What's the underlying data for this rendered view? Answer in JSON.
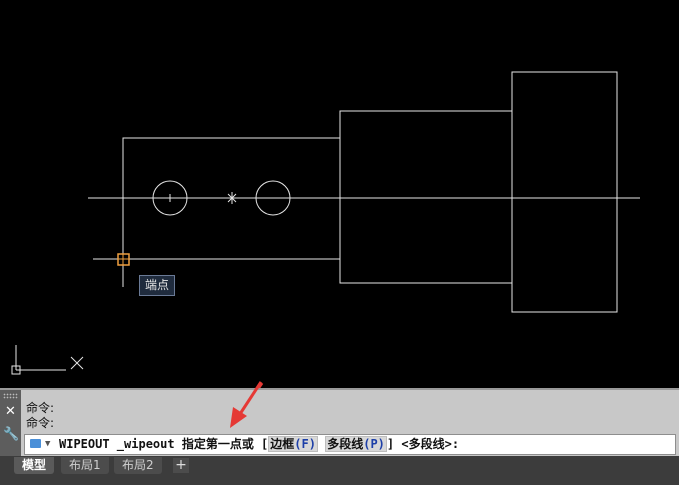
{
  "drawing": {
    "snap_tooltip": "端点",
    "ucs_icon": "ucs-icon",
    "annotation_arrow_color": "#e53935"
  },
  "command_line": {
    "history": [
      "命令:",
      "命令:"
    ],
    "input_prefix": "WIPEOUT _wipeout 指定第一点或 [",
    "option1_label": "边框",
    "option1_key": "(F)",
    "option2_label": "多段线",
    "option2_key": "(P)",
    "input_suffix": "] <多段线>:",
    "close_icon": "close-icon",
    "customize_icon": "wrench-icon"
  },
  "tabs": {
    "model": "模型",
    "layout1": "布局1",
    "layout2": "布局2",
    "add": "+"
  },
  "colors": {
    "canvas_bg": "#000000",
    "geometry": "#ffffff",
    "snap_marker": "#f0a040",
    "tooltip_bg": "#1f2b3d"
  }
}
